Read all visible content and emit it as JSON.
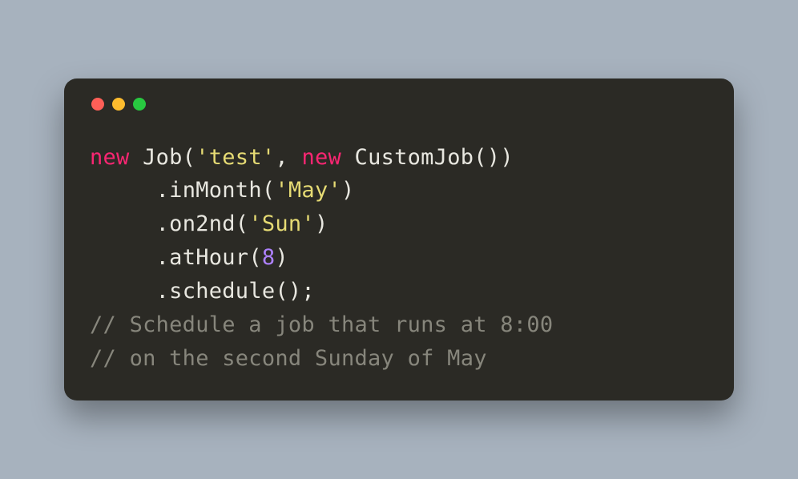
{
  "colors": {
    "background": "#a7b2be",
    "window_bg": "#2b2a25",
    "traffic_red": "#ff5f57",
    "traffic_yellow": "#febc2e",
    "traffic_green": "#28c840",
    "keyword": "#f92672",
    "plain": "#e8e7e0",
    "string": "#e6db74",
    "number": "#ae81ff",
    "comment": "#87867c"
  },
  "code": {
    "l1": {
      "kw1": "new",
      "sp1": " ",
      "fn1": "Job(",
      "str1": "'test'",
      "comma": ", ",
      "kw2": "new",
      "sp2": " ",
      "fn2": "CustomJob())"
    },
    "l2": {
      "indent": "     ",
      "call": ".inMonth(",
      "str": "'May'",
      "close": ")"
    },
    "l3": {
      "indent": "     ",
      "call": ".on2nd(",
      "str": "'Sun'",
      "close": ")"
    },
    "l4": {
      "indent": "     ",
      "call": ".atHour(",
      "num": "8",
      "close": ")"
    },
    "l5": {
      "indent": "     ",
      "call": ".schedule();"
    },
    "l6": "// Schedule a job that runs at 8:00",
    "l7": "// on the second Sunday of May"
  }
}
